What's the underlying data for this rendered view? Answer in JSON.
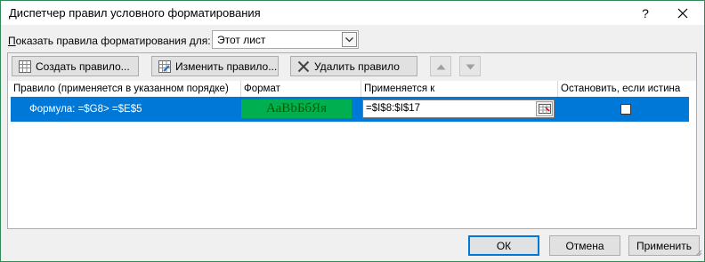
{
  "window": {
    "title": "Диспетчер правил условного форматирования",
    "help_label": "?",
    "titlebar_color": "#1e7f4e"
  },
  "show": {
    "label_prefix": "П",
    "label_rest": "оказать правила форматирования для:",
    "selected": "Этот лист"
  },
  "toolbar": {
    "new_rule": "Создать правило...",
    "edit_rule": "Изменить правило...",
    "delete_rule": "Удалить правило"
  },
  "columns": {
    "rule": "Правило (применяется в указанном порядке)",
    "format": "Формат",
    "applies_to": "Применяется к",
    "stop_if_true": "Остановить, если истина"
  },
  "rules": [
    {
      "formula": "Формула: =$G8> =$E$5",
      "format_preview": "АаBbБбЯя",
      "applies_to": "=$I$8:$I$17",
      "stop_if_true": false
    }
  ],
  "buttons": {
    "ok": "ОК",
    "cancel": "Отмена",
    "apply": "Применить"
  },
  "colors": {
    "selection": "#0078d7",
    "format_fill": "#00b050",
    "format_text": "#006100"
  }
}
